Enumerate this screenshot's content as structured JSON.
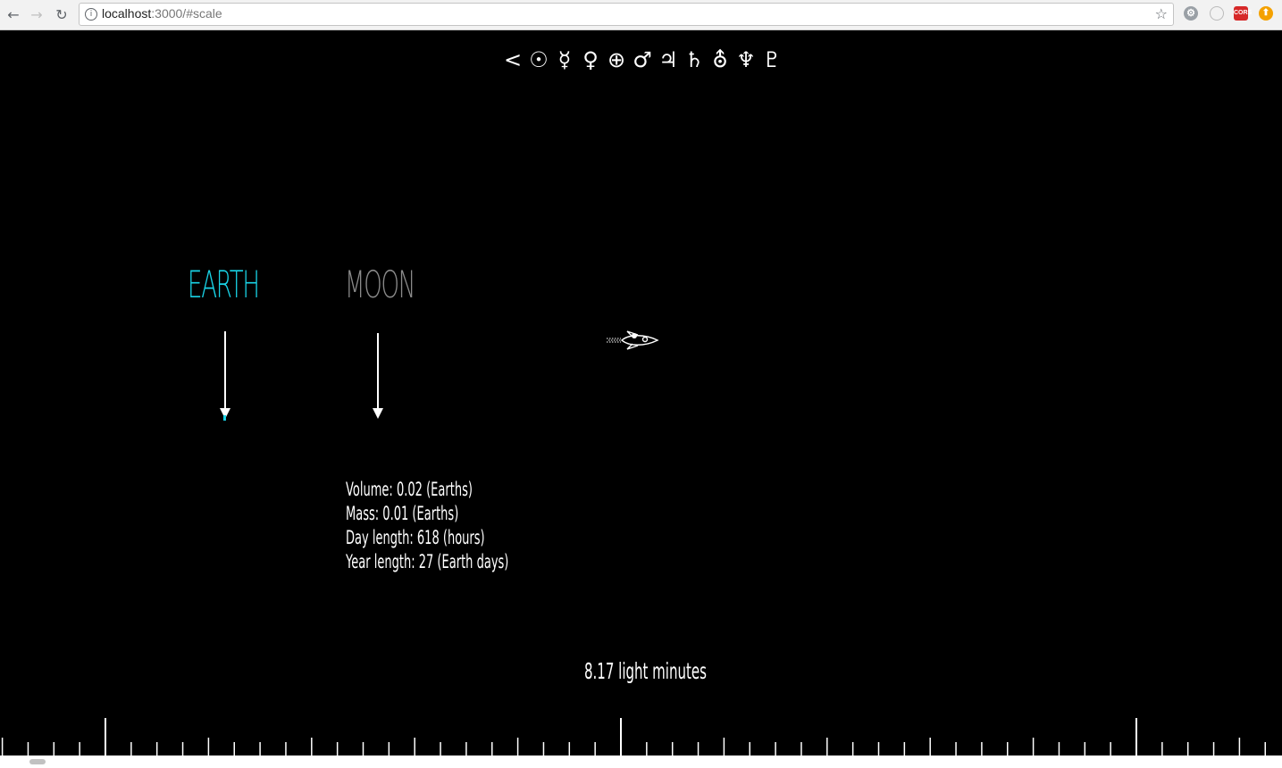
{
  "browser": {
    "url_host": "localhost",
    "url_rest": ":3000/#scale",
    "extensions": [
      "gear-icon",
      "circle-icon",
      "CORS",
      "up-arrow-icon"
    ]
  },
  "planet_nav": {
    "items": [
      "<",
      "☉",
      "☿",
      "♀",
      "⊕",
      "♂",
      "♃",
      "♄",
      "⛢",
      "♆",
      "♇"
    ]
  },
  "bodies": {
    "earth": {
      "label": "EARTH",
      "color": "#19d3e6"
    },
    "moon": {
      "label": "MOON",
      "color": "#8a8a8a"
    }
  },
  "moon_info": {
    "volume": "Volume: 0.02 (Earths)",
    "mass": "Mass: 0.01 (Earths)",
    "day_length": "Day length: 618 (hours)",
    "year_length": "Year length: 27 (Earth days)"
  },
  "distance": {
    "label": "8.17  light minutes"
  }
}
